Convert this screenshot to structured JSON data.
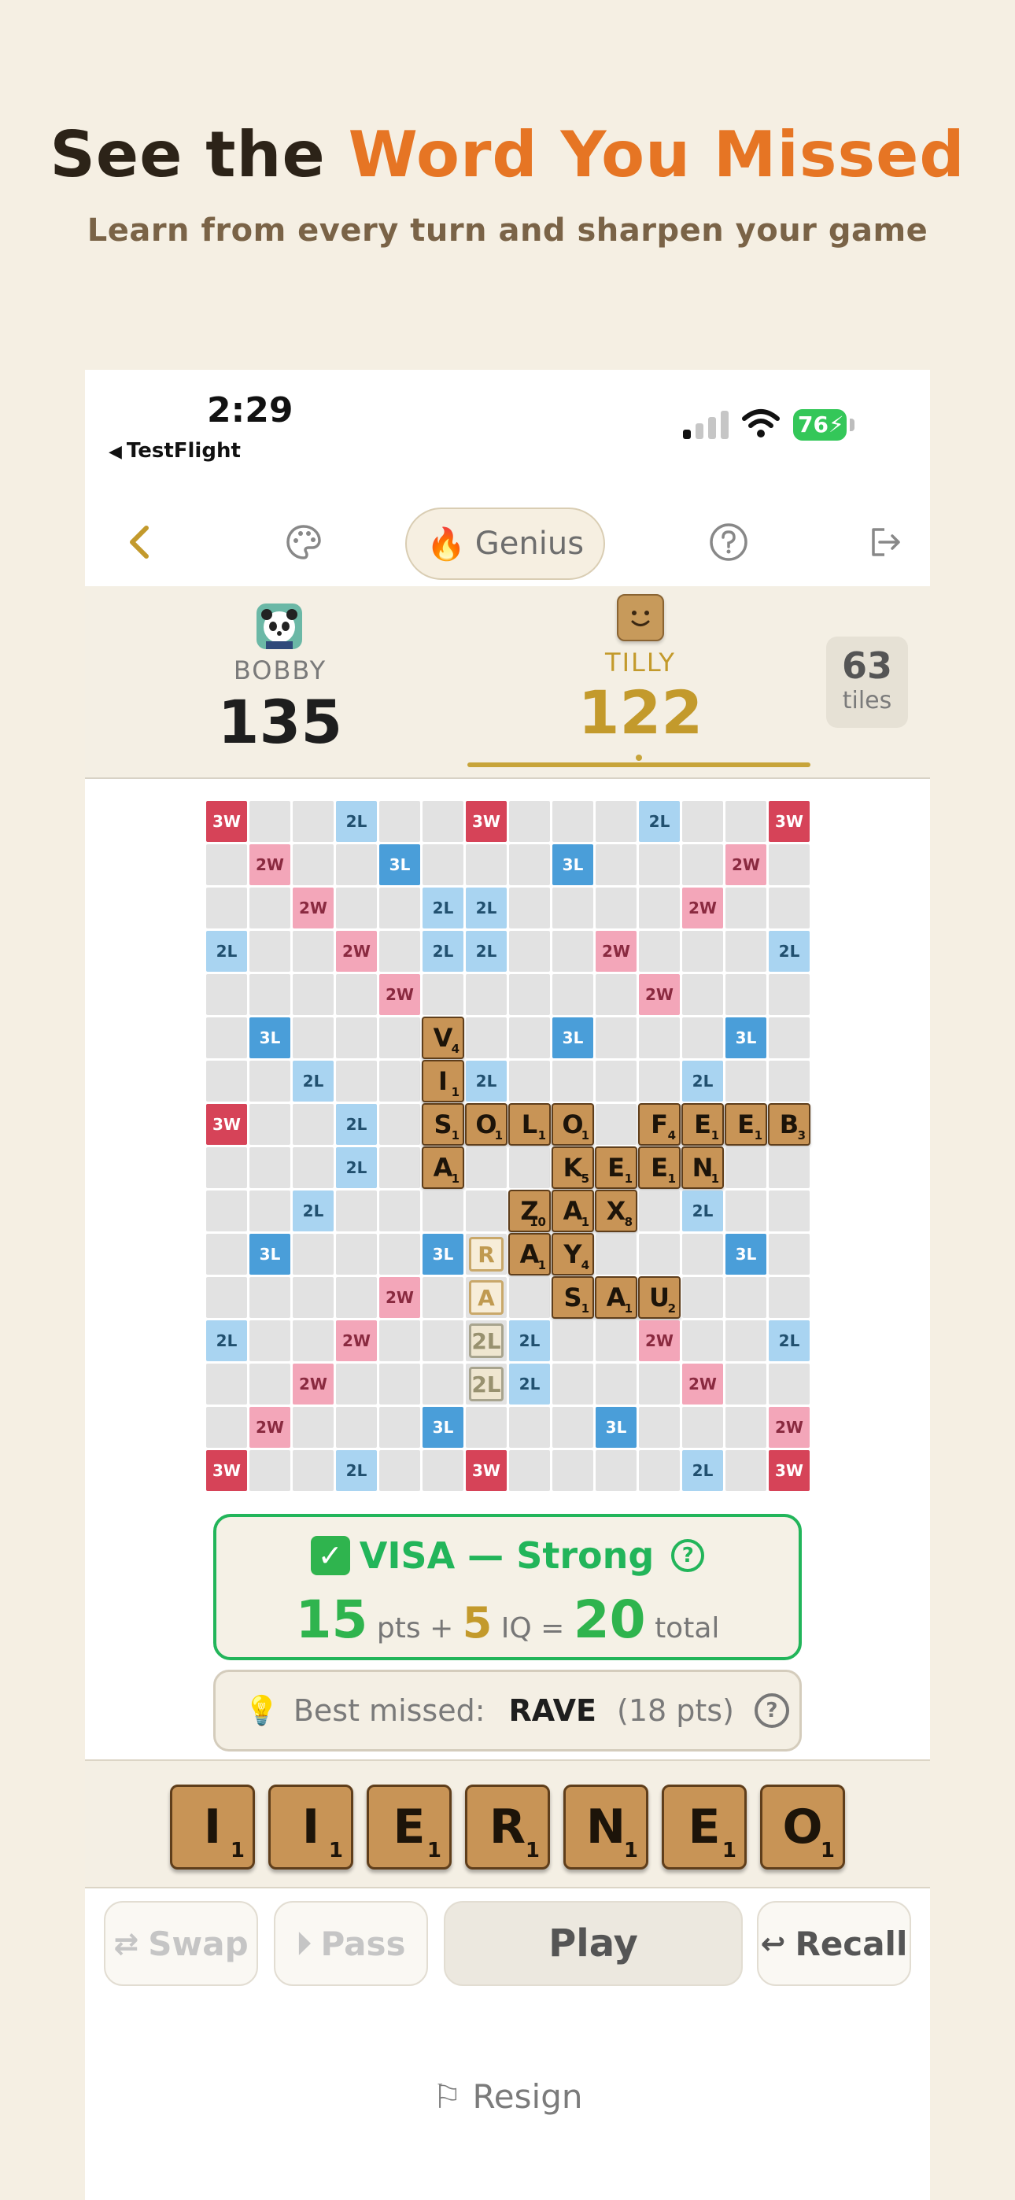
{
  "headline": {
    "part1": "See the ",
    "accent": "Word You Missed"
  },
  "subhead": "Learn from every turn and sharpen your game",
  "status": {
    "time": "2:29",
    "back_app": "TestFlight",
    "battery": "76"
  },
  "nav": {
    "difficulty": "Genius"
  },
  "players": {
    "p1": {
      "name": "BOBBY",
      "score": "135"
    },
    "p2": {
      "name": "TILLY",
      "score": "122"
    }
  },
  "tiles_left": {
    "count": "63",
    "label": "tiles"
  },
  "result": {
    "title": "VISA — Strong",
    "pts": "15",
    "pts_label": "pts +",
    "iq": "5",
    "iq_label": "IQ =",
    "total": "20",
    "total_label": "total"
  },
  "best_missed": {
    "label": "Best missed:",
    "word": "RAVE",
    "pts": "(18 pts)"
  },
  "rack": [
    {
      "l": "I",
      "v": "1"
    },
    {
      "l": "I",
      "v": "1"
    },
    {
      "l": "E",
      "v": "1"
    },
    {
      "l": "R",
      "v": "1"
    },
    {
      "l": "N",
      "v": "1"
    },
    {
      "l": "E",
      "v": "1"
    },
    {
      "l": "O",
      "v": "1"
    }
  ],
  "buttons": {
    "swap": "Swap",
    "pass": "Pass",
    "play": "Play",
    "recall": "Recall",
    "resign": "Resign"
  },
  "board": {
    "premiums": [
      "T..D..T...D..T",
      ".W..3...3...W.",
      "..W..DD....W..",
      "D..W.DD..W...D",
      "....W.....W...",
      ".3......3...3.",
      "..D...D....D..",
      "T..D..........",
      "...D..........",
      "..D........D..",
      ".3...3......3.",
      "....W.........",
      "D..W...D..W..D",
      "..W....D...W..",
      ".W...3...3...W.",
      "T..D..T....D.T"
    ],
    "tiles": [
      {
        "r": 5,
        "c": 5,
        "l": "V",
        "v": "4"
      },
      {
        "r": 6,
        "c": 5,
        "l": "I",
        "v": "1"
      },
      {
        "r": 7,
        "c": 5,
        "l": "S",
        "v": "1"
      },
      {
        "r": 7,
        "c": 6,
        "l": "O",
        "v": "1"
      },
      {
        "r": 7,
        "c": 7,
        "l": "L",
        "v": "1"
      },
      {
        "r": 7,
        "c": 8,
        "l": "O",
        "v": "1"
      },
      {
        "r": 7,
        "c": 10,
        "l": "F",
        "v": "4"
      },
      {
        "r": 7,
        "c": 11,
        "l": "E",
        "v": "1"
      },
      {
        "r": 7,
        "c": 12,
        "l": "E",
        "v": "1"
      },
      {
        "r": 7,
        "c": 13,
        "l": "B",
        "v": "3"
      },
      {
        "r": 8,
        "c": 5,
        "l": "A",
        "v": "1"
      },
      {
        "r": 8,
        "c": 8,
        "l": "K",
        "v": "5"
      },
      {
        "r": 8,
        "c": 9,
        "l": "E",
        "v": "1"
      },
      {
        "r": 8,
        "c": 10,
        "l": "E",
        "v": "1"
      },
      {
        "r": 8,
        "c": 11,
        "l": "N",
        "v": "1"
      },
      {
        "r": 9,
        "c": 7,
        "l": "Z",
        "v": "10"
      },
      {
        "r": 9,
        "c": 8,
        "l": "A",
        "v": "1"
      },
      {
        "r": 9,
        "c": 9,
        "l": "X",
        "v": "8"
      },
      {
        "r": 10,
        "c": 7,
        "l": "A",
        "v": "1"
      },
      {
        "r": 10,
        "c": 8,
        "l": "Y",
        "v": "4"
      },
      {
        "r": 11,
        "c": 8,
        "l": "S",
        "v": "1"
      },
      {
        "r": 11,
        "c": 9,
        "l": "A",
        "v": "1"
      },
      {
        "r": 11,
        "c": 10,
        "l": "U",
        "v": "2"
      }
    ],
    "phantom": [
      {
        "r": 10,
        "c": 6,
        "l": "R",
        "style": "gold"
      },
      {
        "r": 11,
        "c": 6,
        "l": "A",
        "style": "gold"
      },
      {
        "r": 12,
        "c": 6,
        "l": "2L",
        "style": "gray"
      },
      {
        "r": 13,
        "c": 6,
        "l": "2L",
        "style": "gray"
      }
    ]
  },
  "colors": {
    "accent": "#e67524",
    "gold": "#c39a2c",
    "green": "#22b55a"
  }
}
